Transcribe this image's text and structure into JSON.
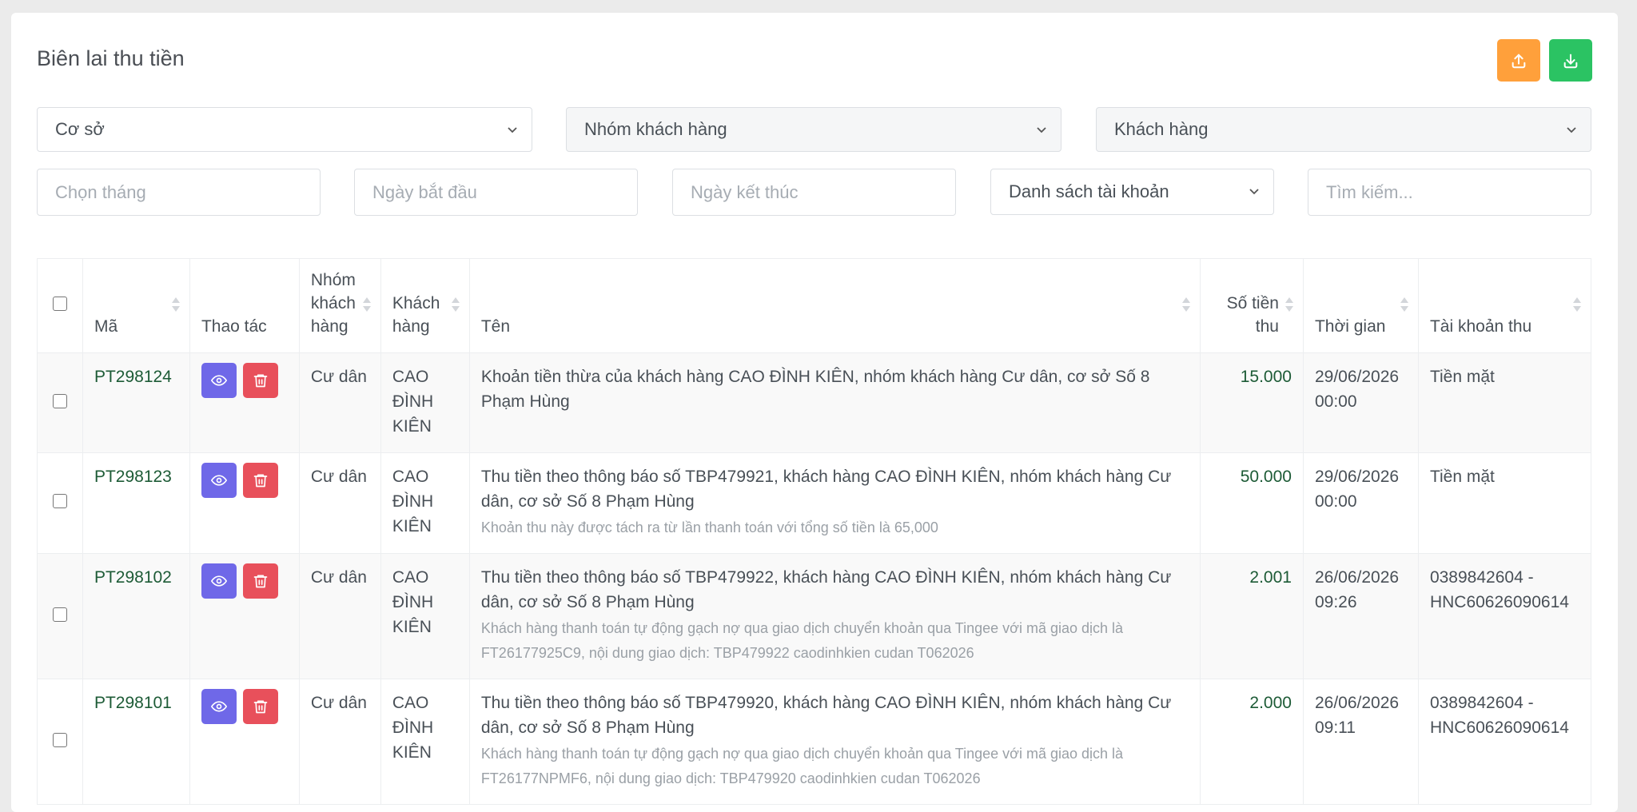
{
  "page": {
    "title": "Biên lai thu tiền"
  },
  "filters": {
    "co_so": "Cơ sở",
    "nhom_khach_hang": "Nhóm khách hàng",
    "khach_hang": "Khách hàng",
    "chon_thang": "Chọn tháng",
    "ngay_bat_dau": "Ngày bắt đầu",
    "ngay_ket_thuc": "Ngày kết thúc",
    "danh_sach_tai_khoan": "Danh sách tài khoản",
    "tim_kiem": "Tìm kiếm..."
  },
  "table": {
    "headers": {
      "ma": "Mã",
      "thao_tac": "Thao tác",
      "nhom_kh_1": "Nhóm",
      "nhom_kh_2": "khách",
      "nhom_kh_3": "hàng",
      "khach_hang_1": "Khách",
      "khach_hang_2": "hàng",
      "ten": "Tên",
      "so_tien_1": "Số tiền",
      "so_tien_2": "thu",
      "thoi_gian": "Thời gian",
      "tai_khoan_thu": "Tài khoản thu"
    },
    "rows": [
      {
        "code": "PT298124",
        "group": "Cư dân",
        "customer": "CAO ĐÌNH KIÊN",
        "name": "Khoản tiền thừa của khách hàng CAO ĐÌNH KIÊN, nhóm khách hàng Cư dân, cơ sở Số 8 Phạm Hùng",
        "note": "",
        "amount": "15.000",
        "date": "29/06/2026",
        "time": "00:00",
        "account_1": "Tiền mặt",
        "account_2": ""
      },
      {
        "code": "PT298123",
        "group": "Cư dân",
        "customer": "CAO ĐÌNH KIÊN",
        "name": "Thu tiền theo thông báo số TBP479921, khách hàng CAO ĐÌNH KIÊN, nhóm khách hàng Cư dân, cơ sở Số 8 Phạm Hùng",
        "note": "Khoản thu này được tách ra từ lần thanh toán với tổng số tiền là 65,000",
        "amount": "50.000",
        "date": "29/06/2026",
        "time": "00:00",
        "account_1": "Tiền mặt",
        "account_2": ""
      },
      {
        "code": "PT298102",
        "group": "Cư dân",
        "customer": "CAO ĐÌNH KIÊN",
        "name": "Thu tiền theo thông báo số TBP479922, khách hàng CAO ĐÌNH KIÊN, nhóm khách hàng Cư dân, cơ sở Số 8 Phạm Hùng",
        "note": "Khách hàng thanh toán tự động gạch nợ qua giao dịch chuyển khoản qua Tingee với mã giao dịch là FT26177925C9, nội dung giao dịch: TBP479922 caodinhkien cudan T062026",
        "amount": "2.001",
        "date": "26/06/2026",
        "time": "09:26",
        "account_1": "0389842604 -",
        "account_2": "HNC60626090614"
      },
      {
        "code": "PT298101",
        "group": "Cư dân",
        "customer": "CAO ĐÌNH KIÊN",
        "name": "Thu tiền theo thông báo số TBP479920, khách hàng CAO ĐÌNH KIÊN, nhóm khách hàng Cư dân, cơ sở Số 8 Phạm Hùng",
        "note": "Khách hàng thanh toán tự động gạch nợ qua giao dịch chuyển khoản qua Tingee với mã giao dịch là FT26177NPMF6, nội dung giao dịch: TBP479920 caodinhkien cudan T062026",
        "amount": "2.000",
        "date": "26/06/2026",
        "time": "09:11",
        "account_1": "0389842604 -",
        "account_2": "HNC60626090614"
      }
    ]
  }
}
